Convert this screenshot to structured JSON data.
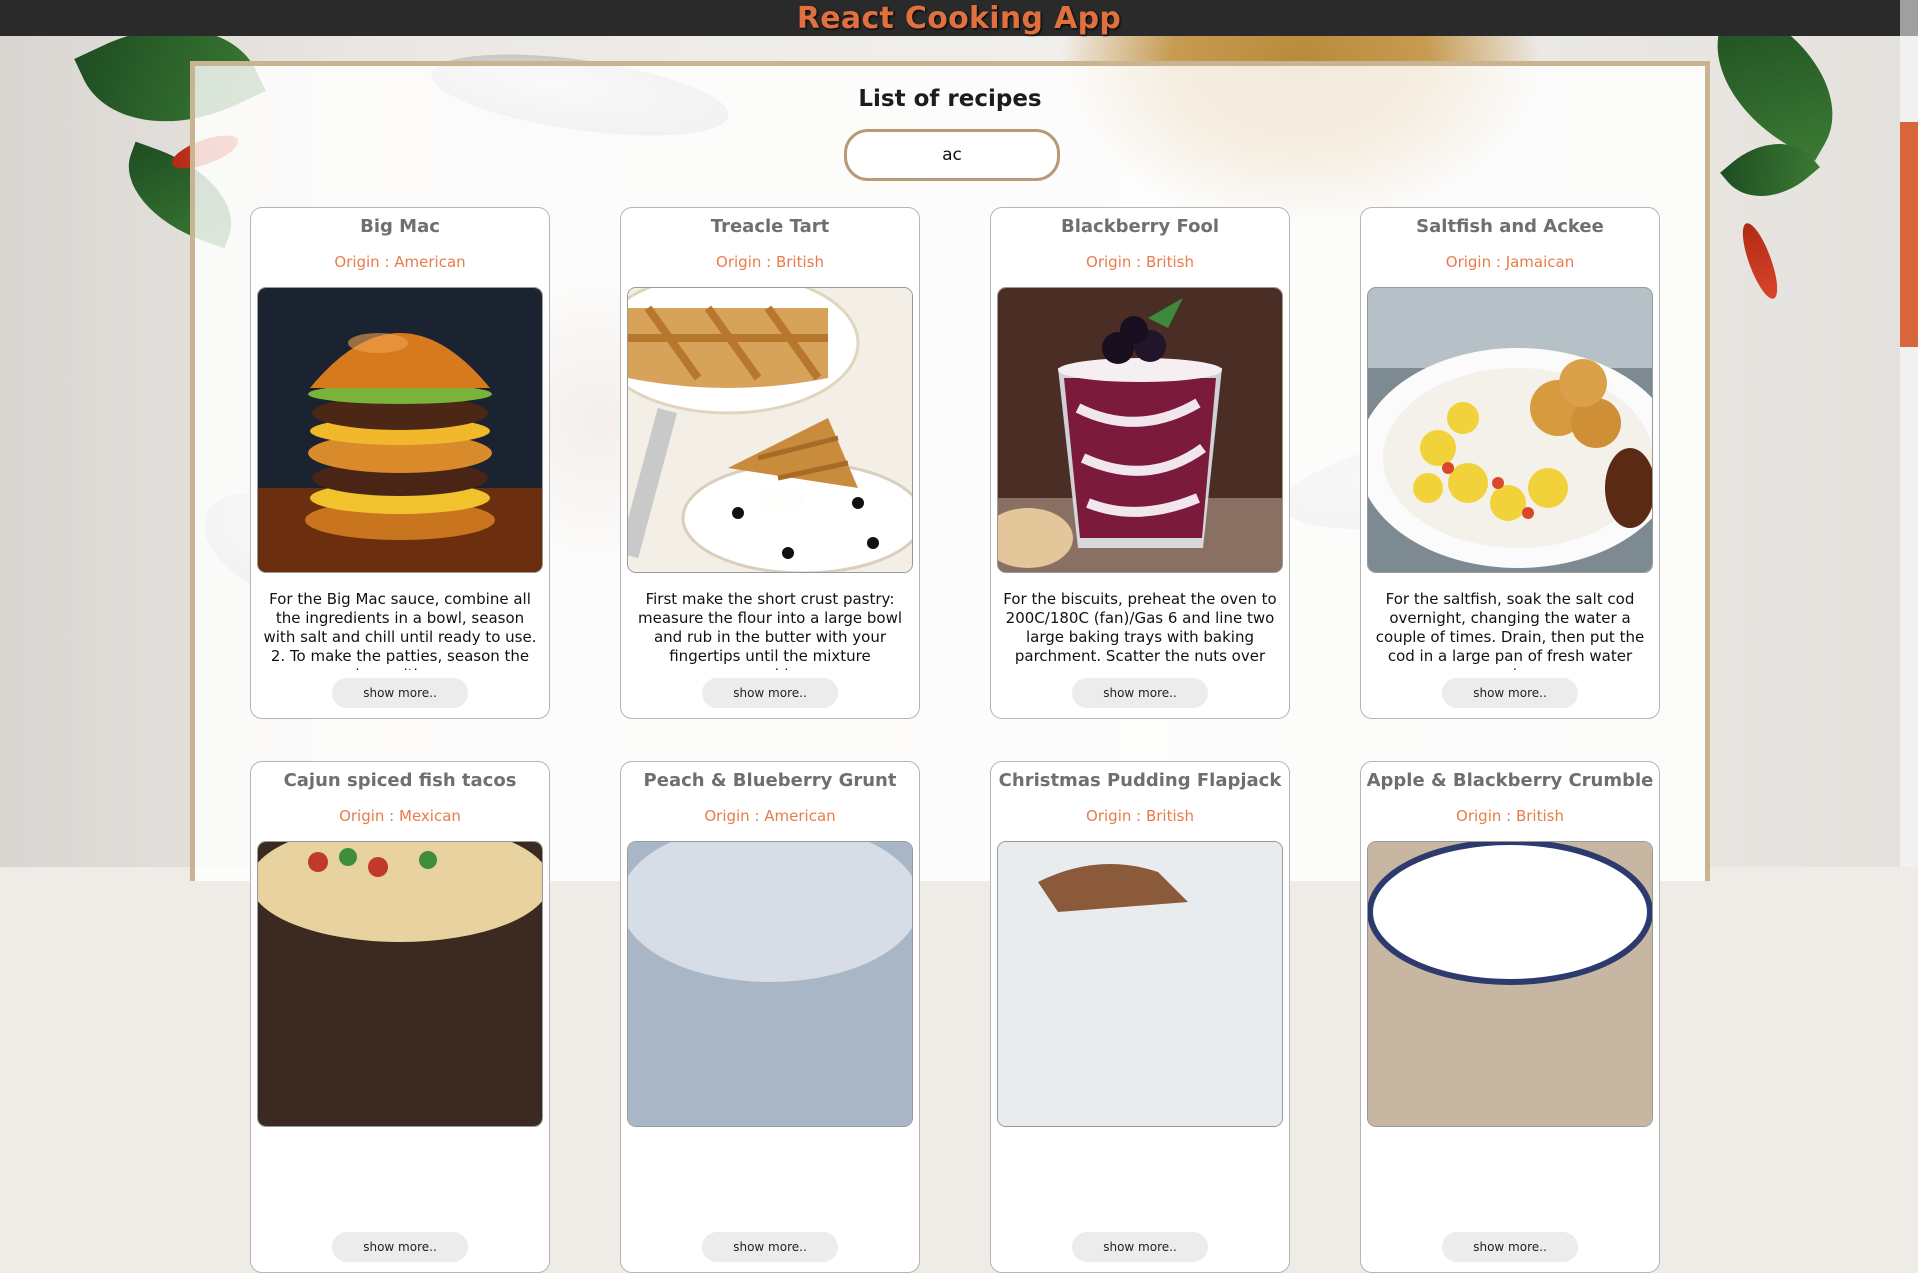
{
  "app": {
    "title": "React Cooking App"
  },
  "page": {
    "title": "List of recipes"
  },
  "search": {
    "value": "ac",
    "placeholder": ""
  },
  "colors": {
    "accent": "#e0703d",
    "origin": "#ea7b4a",
    "panel_border": "#c9b491",
    "search_border": "#b89a77"
  },
  "recipes": [
    {
      "name": "Big Mac",
      "origin": "Origin : American",
      "description": "For the Big Mac sauce, combine all the ingredients in a bowl, season with salt and chill until ready to use. 2. To make the patties, season the mince with sa...",
      "button": "show more..",
      "image": "burger"
    },
    {
      "name": "Treacle Tart",
      "origin": "Origin : British",
      "description": "First make the short crust pastry: measure the flour into a large bowl and rub in the butter with your fingertips until the mixture resemble...",
      "button": "show more..",
      "image": "tart"
    },
    {
      "name": "Blackberry Fool",
      "origin": "Origin : British",
      "description": "For the biscuits, preheat the oven to 200C/180C (fan)/Gas 6 and line two large baking trays with baking parchment. Scatter the nuts over a...",
      "button": "show more..",
      "image": "fool"
    },
    {
      "name": "Saltfish and Ackee",
      "origin": "Origin : Jamaican",
      "description": "For the saltfish, soak the salt cod overnight, changing the water a couple of times. Drain, then put the cod in a large pan of fresh water and...",
      "button": "show more..",
      "image": "ackee"
    },
    {
      "name": "Cajun spiced fish tacos",
      "origin": "Origin : Mexican",
      "description": "",
      "button": "show more..",
      "image": "tacos"
    },
    {
      "name": "Peach & Blueberry Grunt",
      "origin": "Origin : American",
      "description": "",
      "button": "show more..",
      "image": "grunt"
    },
    {
      "name": "Christmas Pudding Flapjack",
      "origin": "Origin : British",
      "description": "",
      "button": "show more..",
      "image": "flapjack"
    },
    {
      "name": "Apple & Blackberry Crumble",
      "origin": "Origin : British",
      "description": "",
      "button": "show more..",
      "image": "crumble"
    }
  ]
}
